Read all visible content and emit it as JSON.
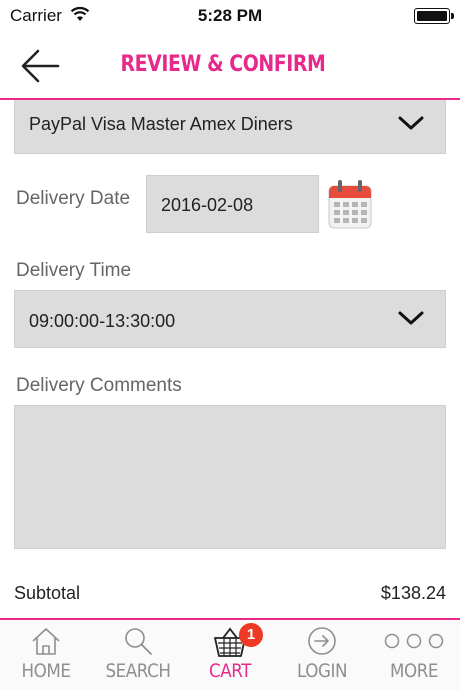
{
  "status_bar": {
    "carrier": "Carrier",
    "time": "5:28 PM"
  },
  "header": {
    "title": "REVIEW & CONFIRM",
    "accent_color": "#e8298c"
  },
  "form": {
    "payment_method": {
      "selected": "PayPal Visa Master Amex Diners"
    },
    "delivery_date": {
      "label": "Delivery Date",
      "value": "2016-02-08"
    },
    "delivery_time": {
      "label": "Delivery Time",
      "selected": "09:00:00-13:30:00"
    },
    "delivery_comments": {
      "label": "Delivery Comments",
      "value": ""
    }
  },
  "summary": {
    "subtotal_label": "Subtotal",
    "subtotal_value": "$138.24"
  },
  "tabs": [
    {
      "label": "HOME",
      "icon": "home-icon"
    },
    {
      "label": "SEARCH",
      "icon": "search-icon"
    },
    {
      "label": "CART",
      "icon": "cart-icon",
      "badge": "1",
      "active": true
    },
    {
      "label": "LOGIN",
      "icon": "login-icon"
    },
    {
      "label": "MORE",
      "icon": "more-icon"
    }
  ]
}
